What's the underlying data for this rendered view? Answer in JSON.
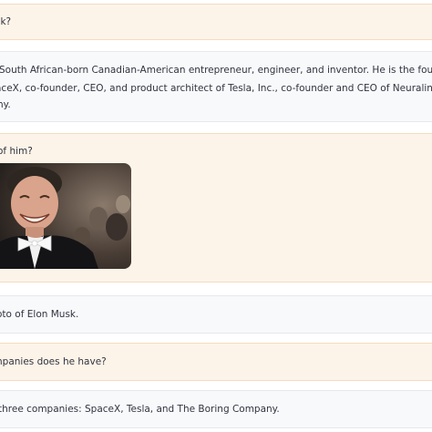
{
  "chat": {
    "messages": [
      {
        "role": "user",
        "text": "sk?"
      },
      {
        "role": "assistant",
        "lines": [
          "South African-born Canadian-American entrepreneur, engineer, and inventor. He is the founder, CEO, an",
          "aceX, co-founder, CEO, and product architect of Tesla, Inc., co-founder and CEO of Neuralink, and founde",
          "ny."
        ]
      },
      {
        "role": "user",
        "text": "of him?"
      },
      {
        "role": "assistant",
        "text": "oto of Elon Musk."
      },
      {
        "role": "user",
        "text": "npanies does he have?"
      },
      {
        "role": "assistant",
        "text": "three companies: SpaceX, Tesla, and The Boring Company."
      }
    ]
  },
  "colors": {
    "user_bg": "#fdf4e9",
    "assistant_bg": "#f8f9fb",
    "text": "#31333f"
  }
}
